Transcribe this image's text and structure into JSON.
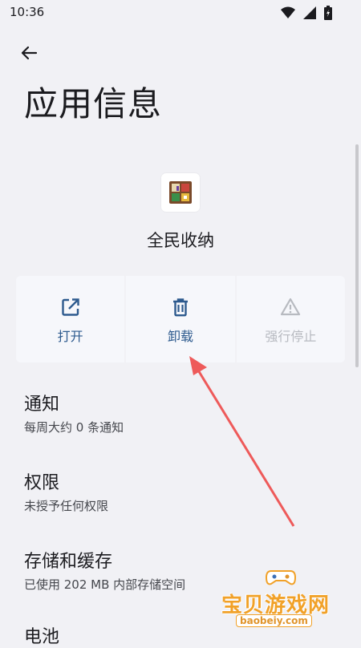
{
  "status_bar": {
    "time": "10:36"
  },
  "page": {
    "title": "应用信息"
  },
  "app": {
    "name": "全民收纳"
  },
  "actions": [
    {
      "label": "打开",
      "icon": "open-external-icon",
      "enabled": true
    },
    {
      "label": "卸载",
      "icon": "trash-icon",
      "enabled": true
    },
    {
      "label": "强行停止",
      "icon": "warning-icon",
      "enabled": false
    }
  ],
  "settings": [
    {
      "title": "通知",
      "subtitle": "每周大约 0 条通知"
    },
    {
      "title": "权限",
      "subtitle": "未授予任何权限"
    },
    {
      "title": "存储和缓存",
      "subtitle": "已使用 202 MB 内部存储空间"
    },
    {
      "title": "电池",
      "subtitle": ""
    }
  ],
  "watermark": {
    "text": "宝贝游戏网",
    "url": "baobeiy.com"
  },
  "colors": {
    "accent": "#2d5a8e",
    "disabled": "#b7bac0",
    "background": "#f1f1f5",
    "arrow": "#ee5a5a"
  }
}
